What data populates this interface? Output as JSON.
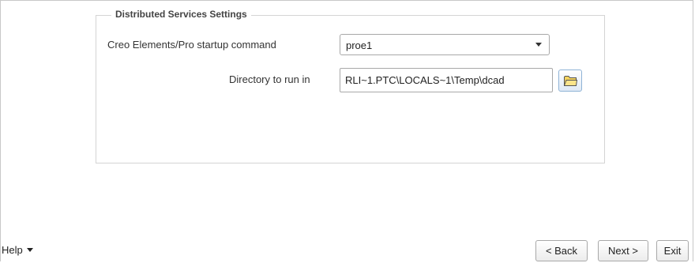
{
  "settings": {
    "legend": "Distributed Services Settings",
    "startup_command_label": "Creo Elements/Pro startup command",
    "startup_command_value": "proe1",
    "directory_label": "Directory to run in",
    "directory_value": "RLI~1.PTC\\LOCALS~1\\Temp\\dcad"
  },
  "footer": {
    "help_label": "Help",
    "back_label": "< Back",
    "next_label": "Next >",
    "exit_label": "Exit"
  },
  "icons": {
    "browse": "folder-icon",
    "dropdown": "chevron-down-icon",
    "help_menu": "caret-down-icon"
  },
  "colors": {
    "border": "#d4d4d4",
    "button_accent": "#8fb3d6",
    "folder_fill": "#f4d35e"
  }
}
